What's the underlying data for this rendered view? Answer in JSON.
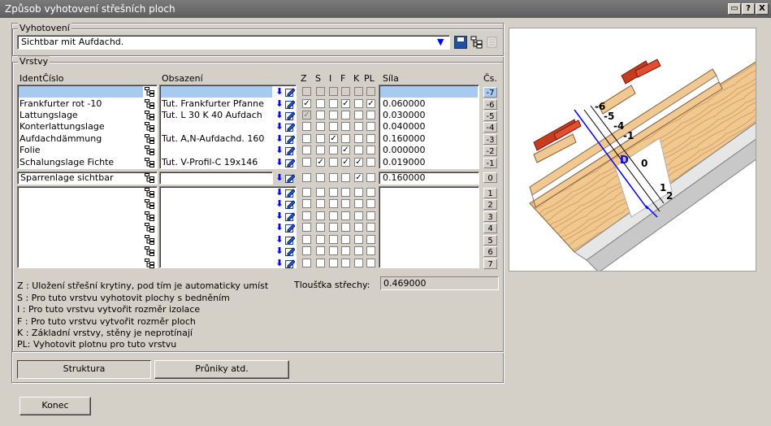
{
  "window": {
    "title": "Způsob vyhotovení střešních ploch",
    "btn_help": "?",
    "btn_close": "X"
  },
  "vyhotoveni": {
    "label": "Vyhotovení",
    "value": "Sichtbar mit Aufdachd."
  },
  "vrstvy": {
    "label": "Vrstvy",
    "headers": {
      "ident": "IdentČíslo",
      "obsazeni": "Obsazení",
      "z": "Z",
      "s": "S",
      "i": "I",
      "f": "F",
      "k": "K",
      "pl": "PL",
      "sila": "Síla",
      "cs": "Čs."
    },
    "upper_rows": [
      {
        "ident": "",
        "obs": "",
        "z": false,
        "s": false,
        "i": false,
        "f": false,
        "k": false,
        "pl": false,
        "sila": "",
        "cs": "-7"
      },
      {
        "ident": "Frankfurter rot -10",
        "obs": "Tut. Frankfurter Pfanne",
        "z": true,
        "s": false,
        "i": false,
        "f": true,
        "k": false,
        "pl": true,
        "sila": "0.060000",
        "cs": "-6"
      },
      {
        "ident": "Lattungslage",
        "obs": "Tut. L  30 K  40 Aufdach",
        "z": true,
        "s": false,
        "i": false,
        "f": false,
        "k": false,
        "pl": false,
        "sila": "0.030000",
        "cs": "-5"
      },
      {
        "ident": "Konterlattungslage",
        "obs": "",
        "z": false,
        "s": false,
        "i": false,
        "f": false,
        "k": false,
        "pl": false,
        "sila": "0.040000",
        "cs": "-4"
      },
      {
        "ident": "Aufdachdämmung",
        "obs": "Tut. A,N-Aufdachd. 160",
        "z": false,
        "s": false,
        "i": true,
        "f": false,
        "k": false,
        "pl": false,
        "sila": "0.160000",
        "cs": "-3"
      },
      {
        "ident": "Folie",
        "obs": "",
        "z": false,
        "s": false,
        "i": false,
        "f": true,
        "k": false,
        "pl": false,
        "sila": "0.000000",
        "cs": "-2"
      },
      {
        "ident": "Schalungslage Fichte",
        "obs": "Tut. V-Profil-C  19x146",
        "z": false,
        "s": true,
        "i": false,
        "f": true,
        "k": true,
        "pl": false,
        "sila": "0.019000",
        "cs": "-1"
      }
    ],
    "middle_row": {
      "ident": "Sparrenlage sichtbar",
      "obs": "",
      "k": true,
      "sila": "0.160000",
      "cs": "0"
    },
    "lower_cs": [
      "1",
      "2",
      "3",
      "4",
      "5",
      "6",
      "7"
    ],
    "legend": [
      "Z : Uložení střešní krytiny, pod tím je automaticky umíst",
      "S : Pro tuto vrstvu vyhotovit plochy s bedněním",
      "I : Pro tuto vrstvu vytvořit rozměr izolace",
      "F : Pro tuto vrstvu vytvořit rozměr ploch",
      "K : Základní vrstvy, stěny je neprotínají",
      "PL: Vyhotovit plotnu pro tuto vrstvu"
    ],
    "thickness_label": "Tloušťka střechy:",
    "thickness_value": "0.469000"
  },
  "tabs": {
    "struktura": "Struktura",
    "pruniky": "Průniky atd."
  },
  "konec": "Konec",
  "diagram": {
    "labels": [
      "-6",
      "-5",
      "-4",
      "-1",
      "D",
      "0",
      "1",
      "2"
    ]
  },
  "colors": {
    "title_bar": "#6b6b6b",
    "face": "#d4d0c8",
    "selection": "#a6caf0",
    "arrow": "#0000ff",
    "tile": "#c83c1e",
    "wood": "#f0c890"
  }
}
